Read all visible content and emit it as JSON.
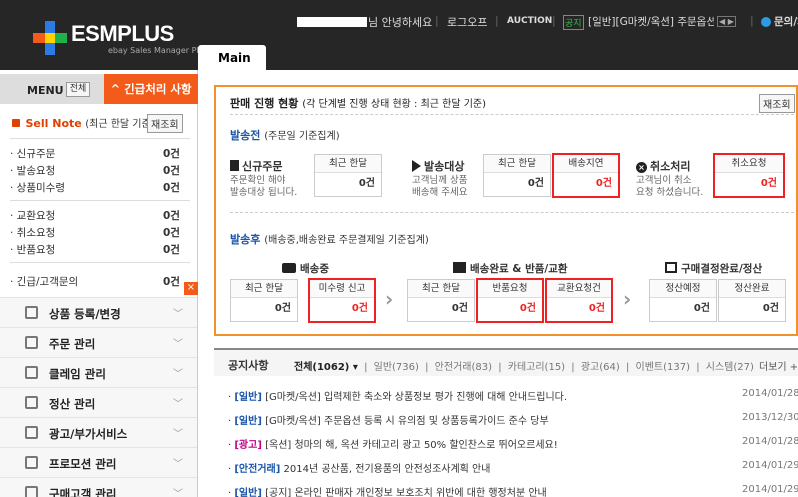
{
  "app": {
    "logo_text": "ESMPLUS",
    "logo_sub": "ebay Sales Manager Plus",
    "tab_main": "Main"
  },
  "topbar": {
    "greeting": "님 안녕하세요",
    "logout": "로그오프",
    "auction": "AUCTION",
    "notice_badge": "공지",
    "notice_text": "[일반][G마켓/옥션] 주문옵션 등록 시 유의",
    "pager": "◀ ▶",
    "inquiry": "문의/채"
  },
  "sidebar": {
    "menu_label": "MENU",
    "menu_all": "전체",
    "urgent_tab": "^ 긴급처리 사항",
    "sellnote_title": "Sell Note",
    "sellnote_sub": "(최근 한달 기준)",
    "sellnote_refresh": "재조회",
    "counts": [
      {
        "label": "· 신규주문",
        "value": "0건"
      },
      {
        "label": "· 발송요청",
        "value": "0건"
      },
      {
        "label": "· 상품미수령",
        "value": "0건"
      },
      {
        "label": "· 교환요청",
        "value": "0건"
      },
      {
        "label": "· 취소요청",
        "value": "0건"
      },
      {
        "label": "· 반품요청",
        "value": "0건"
      },
      {
        "label": "· 긴급/고객문의",
        "value": "0건"
      }
    ],
    "close_mark": "×",
    "nav": [
      {
        "label": "상품 등록/변경",
        "icon": "shirt-icon"
      },
      {
        "label": "주문 관리",
        "icon": "order-icon"
      },
      {
        "label": "클레임 관리",
        "icon": "claim-icon"
      },
      {
        "label": "정산 관리",
        "icon": "settlement-icon"
      },
      {
        "label": "광고/부가서비스",
        "icon": "ad-icon"
      },
      {
        "label": "프로모션 관리",
        "icon": "promotion-icon"
      },
      {
        "label": "구매고객 관리",
        "icon": "customer-icon"
      }
    ]
  },
  "status_panel": {
    "title": "판매 진행 현황",
    "title_sub": "(각 단계별 진행 상태 현황 : 최근 한달 기준)",
    "refresh": "재조회",
    "before": {
      "heading": "발송전",
      "heading_sub": "(주문일 기준집계)",
      "groups": [
        {
          "title": "신규주문",
          "desc1": "주문확인 해야",
          "desc2": "발송대상 됩니다.",
          "cells": [
            {
              "h": "최근 한달",
              "v": "0건",
              "red": false
            }
          ]
        },
        {
          "title": "발송대상",
          "desc1": "고객님께 상품",
          "desc2": "배송해 주세요",
          "cells": [
            {
              "h": "최근 한달",
              "v": "0건",
              "red": false
            },
            {
              "h": "배송지연",
              "v": "0건",
              "red": true
            }
          ]
        },
        {
          "title": "취소처리",
          "desc1": "고객님이 취소",
          "desc2": "요청 하셨습니다.",
          "cells": [
            {
              "h": "취소요청",
              "v": "0건",
              "red": true
            }
          ]
        }
      ]
    },
    "after": {
      "heading": "발송후",
      "heading_sub": "(배송중,배송완료 주문결제일 기준집계)",
      "groups": [
        {
          "title": "배송중",
          "cells": [
            {
              "h": "최근 한달",
              "v": "0건",
              "red": false
            },
            {
              "h": "미수령 신고",
              "v": "0건",
              "red": true
            }
          ]
        },
        {
          "title": "배송완료 & 반품/교환",
          "cells": [
            {
              "h": "최근 한달",
              "v": "0건",
              "red": false
            },
            {
              "h": "반품요청",
              "v": "0건",
              "red": true
            },
            {
              "h": "교환요청건",
              "v": "0건",
              "red": true
            }
          ]
        },
        {
          "title": "구매결정완료/정산",
          "cells": [
            {
              "h": "정산예정",
              "v": "0건",
              "red": false
            },
            {
              "h": "정산완료",
              "v": "0건",
              "red": false
            }
          ]
        }
      ]
    }
  },
  "notices": {
    "title": "공지사항",
    "filters": [
      {
        "label": "전체(1062) ▾",
        "on": true
      },
      {
        "label": "|",
        "on": false
      },
      {
        "label": "일반(736)",
        "on": false
      },
      {
        "label": "|",
        "on": false
      },
      {
        "label": "안전거래(83)",
        "on": false
      },
      {
        "label": "|",
        "on": false
      },
      {
        "label": "카테고리(15)",
        "on": false
      },
      {
        "label": "|",
        "on": false
      },
      {
        "label": "광고(64)",
        "on": false
      },
      {
        "label": "|",
        "on": false
      },
      {
        "label": "이벤트(137)",
        "on": false
      },
      {
        "label": "|",
        "on": false
      },
      {
        "label": "시스템(27)",
        "on": false
      }
    ],
    "more": "더보기 +",
    "items": [
      {
        "cat": "[일반]",
        "type": "normal",
        "text": "[G마켓/옥션] 입력제한 축소와 상품정보 평가 진행에 대해 안내드립니다.",
        "date": "2014/01/28"
      },
      {
        "cat": "[일반]",
        "type": "normal",
        "text": "[G마켓/옥션] 주문옵션 등록 시 유의점 및 상품등록가이드 준수 당부",
        "date": "2013/12/30"
      },
      {
        "cat": "[광고]",
        "type": "ad",
        "text": "[옥션] 청마의 해, 옥션 카테고리 광고 50% 할인찬스로 뛰어오르세요!",
        "date": "2014/01/28"
      },
      {
        "cat": "[안전거래]",
        "type": "safe",
        "text": "2014년 공산품, 전기용품의 안전성조사계획 안내",
        "date": "2014/01/29"
      },
      {
        "cat": "[일반]",
        "type": "normal",
        "text": "[공지] 온라인 판매자 개인정보 보호조치 위반에 대한 행정처분 안내",
        "date": "2014/01/29"
      }
    ]
  },
  "colors": {
    "accent": "#f25b19",
    "panel_border": "#f0922b",
    "link_blue": "#1a55a8",
    "alert_red": "#ee2222",
    "header_bg": "#262626"
  }
}
